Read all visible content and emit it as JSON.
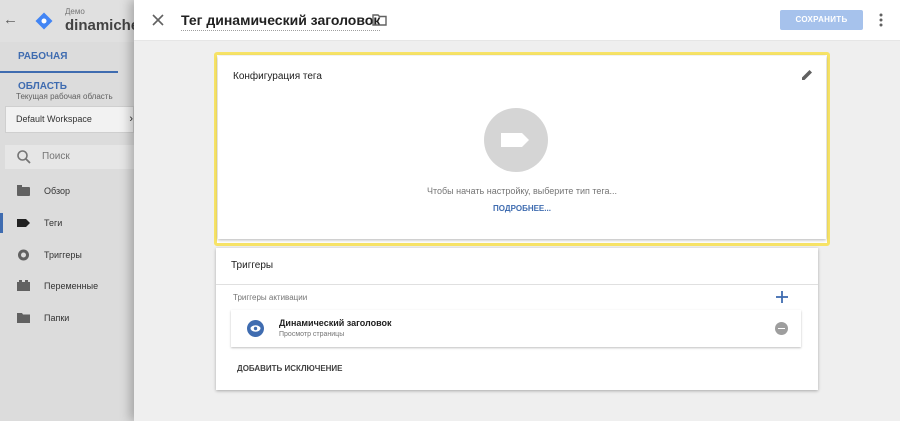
{
  "background": {
    "account_label": "Демо",
    "container_name": "dinamiches",
    "workspace_tab": "РАБОЧАЯ ОБЛАСТЬ",
    "current_workspace_label": "Текущая рабочая область",
    "workspace_value": "Default Workspace",
    "search_placeholder": "Поиск",
    "nav": [
      {
        "label": "Обзор",
        "icon": "overview-icon"
      },
      {
        "label": "Теги",
        "icon": "tag-icon",
        "active": true
      },
      {
        "label": "Триггеры",
        "icon": "trigger-icon"
      },
      {
        "label": "Переменные",
        "icon": "variable-icon"
      },
      {
        "label": "Папки",
        "icon": "folder-icon"
      }
    ]
  },
  "panel": {
    "tag_name": "Тег динамический заголовок",
    "save_label": "СОХРАНИТЬ",
    "config": {
      "title": "Конфигурация тега",
      "hint": "Чтобы начать настройку, выберите тип тега...",
      "learn_more": "ПОДРОБНЕЕ..."
    },
    "triggers": {
      "title": "Триггеры",
      "subtitle": "Триггеры активации",
      "items": [
        {
          "name": "Динамический заголовок",
          "type": "Просмотр страницы"
        }
      ],
      "add_exception": "ДОБАВИТЬ ИСКЛЮЧЕНИЕ"
    }
  },
  "colors": {
    "accent": "#3f6cb0",
    "highlight": "#f7e367",
    "save_disabled": "#a6c2ec"
  }
}
